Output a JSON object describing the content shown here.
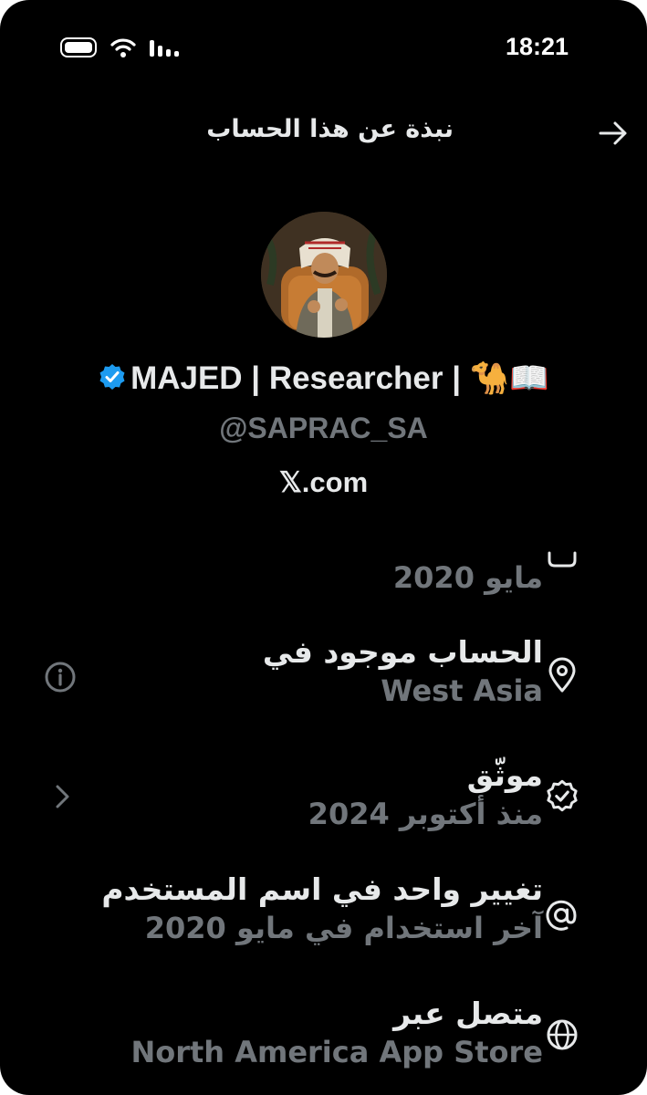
{
  "status_bar": {
    "time": "18:21"
  },
  "header": {
    "title": "نبذة عن هذا الحساب"
  },
  "profile": {
    "display_name": "MAJED | Researcher | 🐪📖",
    "handle": "@SAPRAC_SA",
    "site": "𝕏.com"
  },
  "rows": [
    {
      "subtitle": "مايو 2020",
      "icon": "calendar-icon"
    },
    {
      "title": "الحساب موجود في",
      "subtitle": "West Asia",
      "icon": "location-pin-icon",
      "side_icon": "info-icon"
    },
    {
      "title": "موثّق",
      "subtitle": "منذ أكتوبر 2024",
      "icon": "verified-badge-icon",
      "side_icon": "chevron-right-icon"
    },
    {
      "title": "تغيير واحد في اسم المستخدم",
      "subtitle": "آخر استخدام في مايو 2020",
      "icon": "at-sign-icon"
    },
    {
      "title": "متصل عبر",
      "subtitle": "North America App Store",
      "icon": "globe-icon"
    }
  ],
  "colors": {
    "background": "#000000",
    "primary_text": "#e7e9ea",
    "secondary_text": "#71767b",
    "verified_blue": "#1d9bf0"
  }
}
